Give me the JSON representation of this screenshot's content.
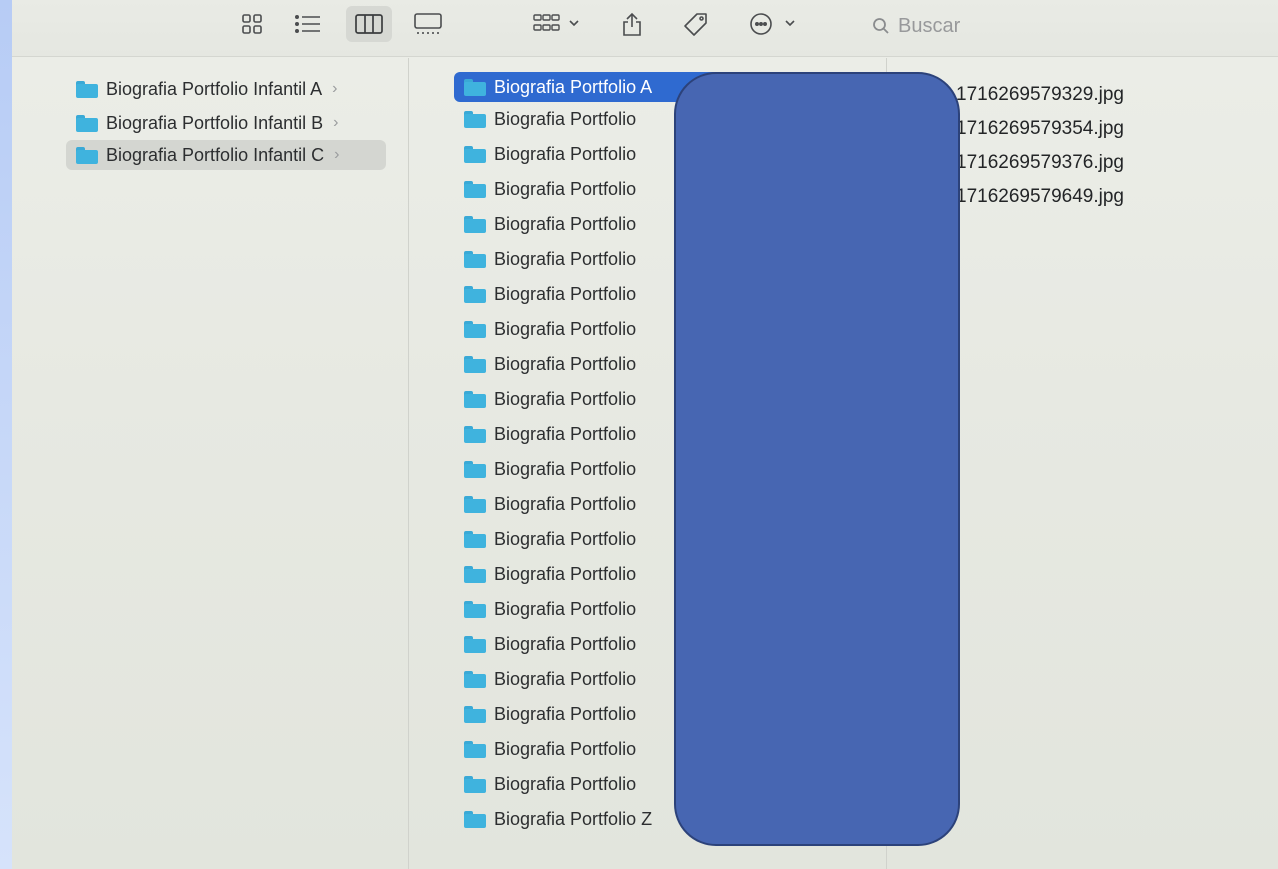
{
  "toolbar": {
    "icons": [
      "grid-view-icon",
      "list-view-icon",
      "column-view-icon",
      "gallery-view-icon",
      "group-by-icon",
      "share-icon",
      "tag-icon",
      "more-actions-icon"
    ],
    "search_placeholder": "Buscar"
  },
  "column1": [
    {
      "label": "Biografia Portfolio Infantil A"
    },
    {
      "label": "Biografia Portfolio Infantil B"
    },
    {
      "label": "Biografia Portfolio Infantil C"
    }
  ],
  "column2": [
    {
      "label": "Biografia Portfolio A"
    },
    {
      "label": "Biografia Portfolio"
    },
    {
      "label": "Biografia Portfolio"
    },
    {
      "label": "Biografia Portfolio"
    },
    {
      "label": "Biografia Portfolio"
    },
    {
      "label": "Biografia Portfolio"
    },
    {
      "label": "Biografia Portfolio"
    },
    {
      "label": "Biografia Portfolio"
    },
    {
      "label": "Biografia Portfolio"
    },
    {
      "label": "Biografia Portfolio"
    },
    {
      "label": "Biografia Portfolio"
    },
    {
      "label": "Biografia Portfolio"
    },
    {
      "label": "Biografia Portfolio"
    },
    {
      "label": "Biografia Portfolio"
    },
    {
      "label": "Biografia Portfolio"
    },
    {
      "label": "Biografia Portfolio"
    },
    {
      "label": "Biografia Portfolio"
    },
    {
      "label": "Biografia Portfolio"
    },
    {
      "label": "Biografia Portfolio"
    },
    {
      "label": "Biografia Portfolio"
    },
    {
      "label": "Biografia Portfolio"
    },
    {
      "label": "Biografia Portfolio Z"
    }
  ],
  "column3": [
    {
      "label": "1716269579329.jpg"
    },
    {
      "label": "1716269579354.jpg"
    },
    {
      "label": "1716269579376.jpg"
    },
    {
      "label": "1716269579649.jpg"
    }
  ],
  "colors": {
    "selection_blue": "#2f6ad0",
    "folder_blue": "#3fb3de",
    "redaction": "#4766b2"
  }
}
